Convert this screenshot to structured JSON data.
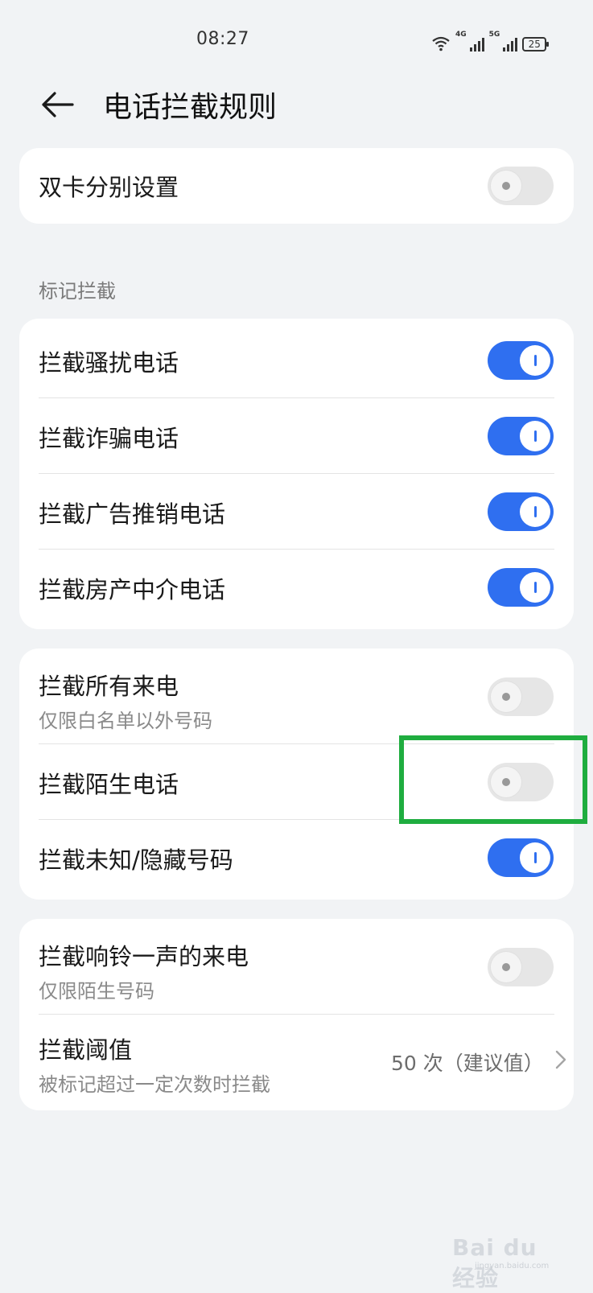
{
  "status_bar": {
    "time": "08:27",
    "battery": "25",
    "net1": "4G",
    "net2": "5G"
  },
  "header": {
    "title": "电话拦截规则"
  },
  "dual_sim": {
    "label": "双卡分别设置",
    "enabled": false
  },
  "mark_section": {
    "title": "标记拦截",
    "items": [
      {
        "label": "拦截骚扰电话",
        "enabled": true
      },
      {
        "label": "拦截诈骗电话",
        "enabled": true
      },
      {
        "label": "拦截广告推销电话",
        "enabled": true
      },
      {
        "label": "拦截房产中介电话",
        "enabled": true
      }
    ]
  },
  "calls_section": {
    "items": [
      {
        "label": "拦截所有来电",
        "sub": "仅限白名单以外号码",
        "enabled": false
      },
      {
        "label": "拦截陌生电话",
        "enabled": false
      },
      {
        "label": "拦截未知/隐藏号码",
        "enabled": true
      }
    ]
  },
  "ring_section": {
    "ring_once": {
      "label": "拦截响铃一声的来电",
      "sub": "仅限陌生号码",
      "enabled": false
    },
    "threshold": {
      "label": "拦截阈值",
      "sub": "被标记超过一定次数时拦截",
      "value": "50 次（建议值）"
    }
  },
  "watermark": {
    "text": "Bai du 经验",
    "sub": "jingyan.baidu.com"
  },
  "colors": {
    "accent": "#2f6ff0",
    "highlight": "#1fad3f",
    "background": "#f1f3f5"
  }
}
